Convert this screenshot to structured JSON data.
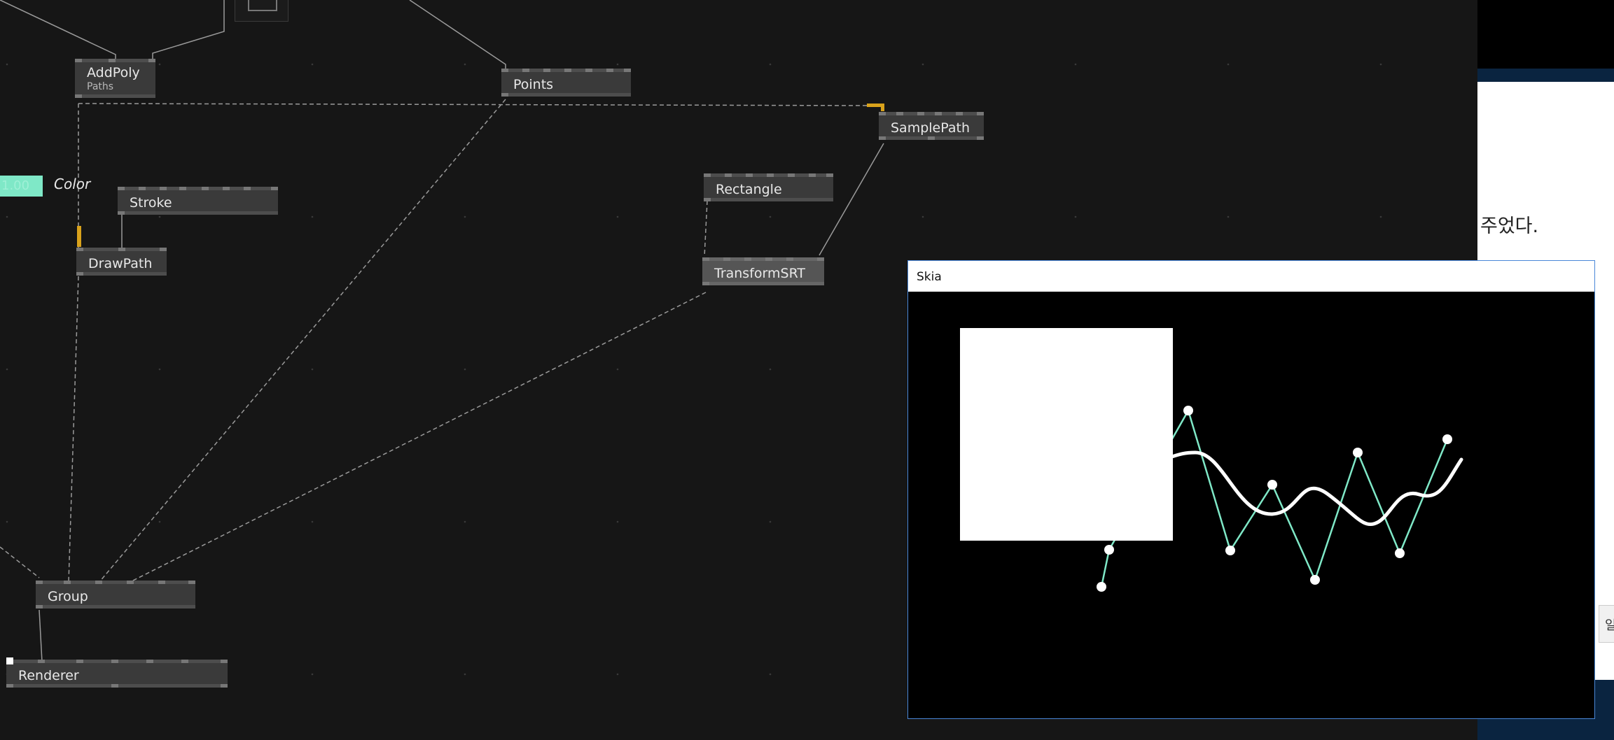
{
  "nodes": {
    "addpoly": {
      "label": "AddPoly",
      "sub": "Paths"
    },
    "points": {
      "label": "Points"
    },
    "samplepath": {
      "label": "SamplePath"
    },
    "stroke": {
      "label": "Stroke"
    },
    "drawpath": {
      "label": "DrawPath"
    },
    "rectangle": {
      "label": "Rectangle"
    },
    "transformsrt": {
      "label": "TransformSRT"
    },
    "group": {
      "label": "Group"
    },
    "renderer": {
      "label": "Renderer"
    }
  },
  "color_iobox": {
    "value": "1.00",
    "label": "Color"
  },
  "skia_window": {
    "title": "Skia"
  },
  "background_app": {
    "text": "주었다.",
    "button_text": "일"
  },
  "colors": {
    "canvas_bg": "#161616",
    "node_bg": "#3a3a3a",
    "wire": "#9a9a9a",
    "accent_orange": "#d9a21b",
    "color_iobox": "#7fe8c7",
    "polyline": "#7fe8c7",
    "window_border": "#4a87d8"
  }
}
